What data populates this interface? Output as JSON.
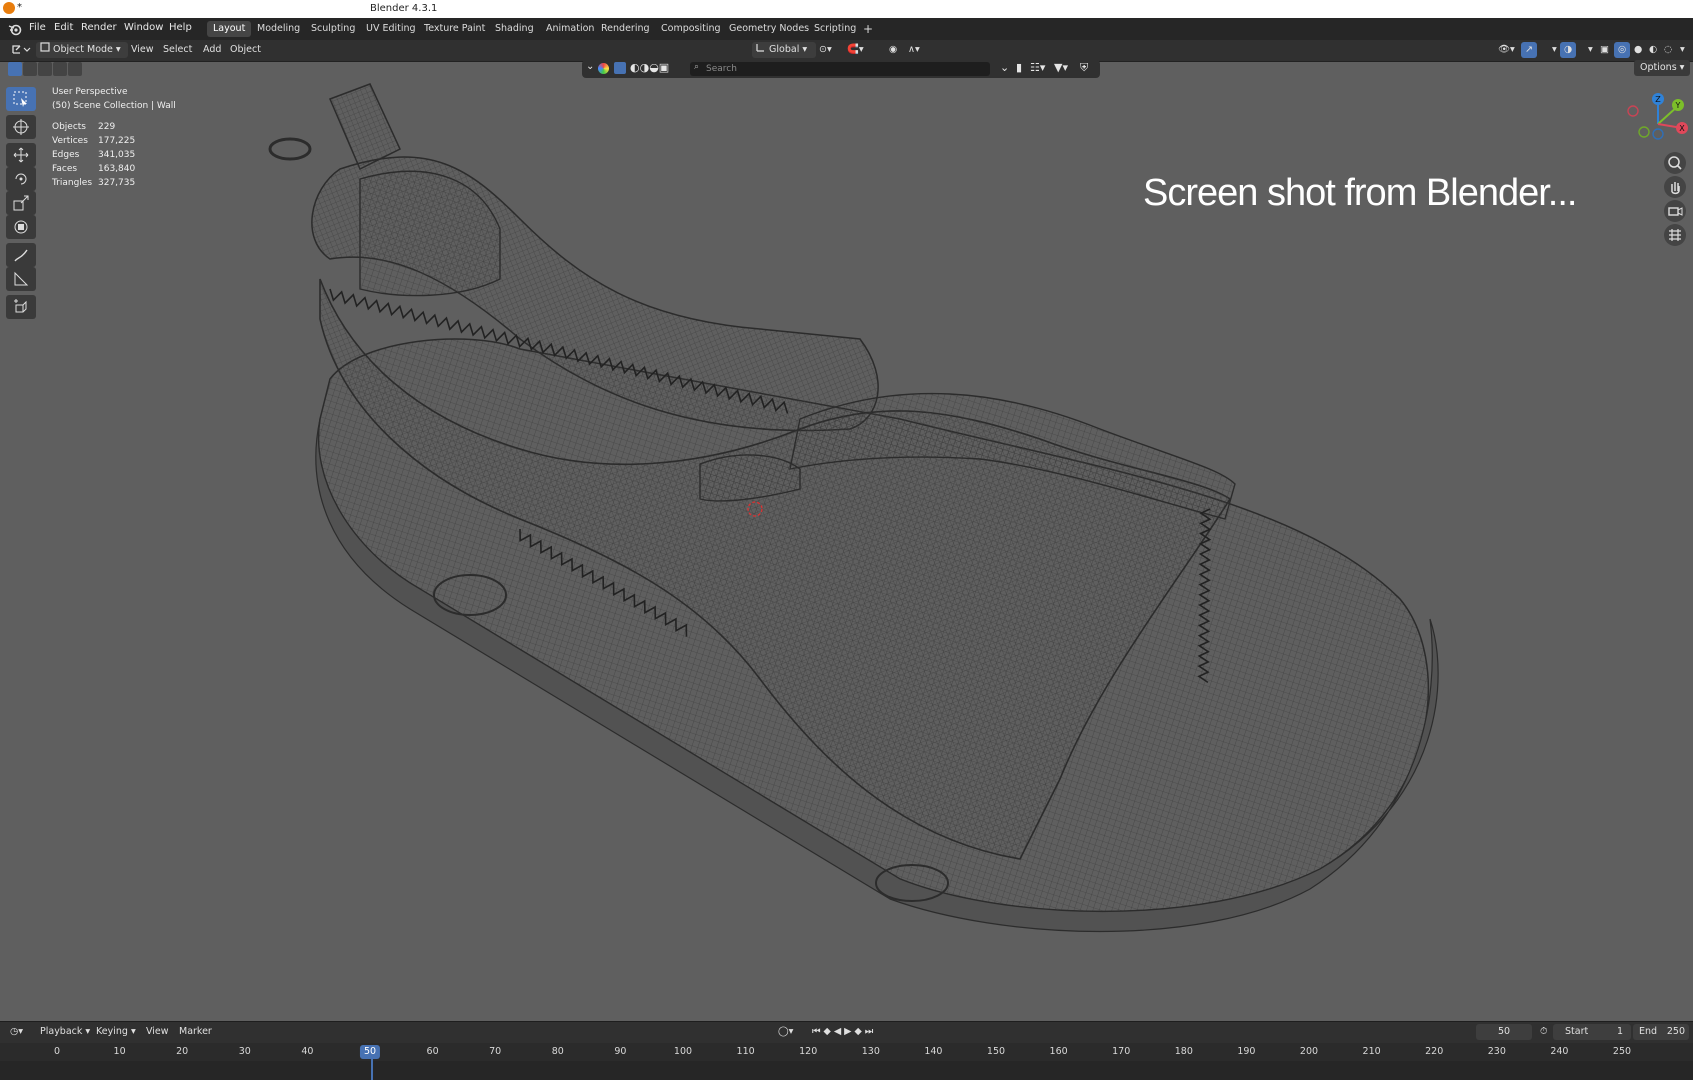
{
  "titlebar": {
    "star": "*",
    "title": "Blender 4.3.1"
  },
  "menu": {
    "file": "File",
    "edit": "Edit",
    "render": "Render",
    "window": "Window",
    "help": "Help"
  },
  "workspaces": [
    "Layout",
    "Modeling",
    "Sculpting",
    "UV Editing",
    "Texture Paint",
    "Shading",
    "Animation",
    "Rendering",
    "Compositing",
    "Geometry Nodes",
    "Scripting"
  ],
  "workspace_add": "+",
  "header": {
    "mode": "Object Mode",
    "view": "View",
    "select": "Select",
    "add": "Add",
    "object": "Object",
    "orientation": "Global"
  },
  "outliner_search_placeholder": "Search",
  "options_label": "Options",
  "viewport": {
    "perspective": "User Perspective",
    "collection": "(50) Scene Collection | Wall",
    "stats": [
      {
        "label": "Objects",
        "value": "229"
      },
      {
        "label": "Vertices",
        "value": "177,225"
      },
      {
        "label": "Edges",
        "value": "341,035"
      },
      {
        "label": "Faces",
        "value": "163,840"
      },
      {
        "label": "Triangles",
        "value": "327,735"
      }
    ],
    "caption": "Screen shot from Blender..."
  },
  "gizmo": {
    "z": "Z",
    "y": "Y",
    "x": "X"
  },
  "timeline": {
    "playback": "Playback",
    "keying": "Keying",
    "view": "View",
    "marker": "Marker",
    "current_frame": "50",
    "start_label": "Start",
    "start": "1",
    "end_label": "End",
    "end": "250",
    "ticks": [
      "0",
      "10",
      "20",
      "30",
      "40",
      "50",
      "60",
      "70",
      "80",
      "90",
      "100",
      "110",
      "120",
      "130",
      "140",
      "150",
      "160",
      "170",
      "180",
      "190",
      "200",
      "210",
      "220",
      "230",
      "240",
      "250"
    ]
  },
  "colors": {
    "accent": "#4772b3",
    "bg": "#5f5f5f",
    "header": "#303030"
  }
}
